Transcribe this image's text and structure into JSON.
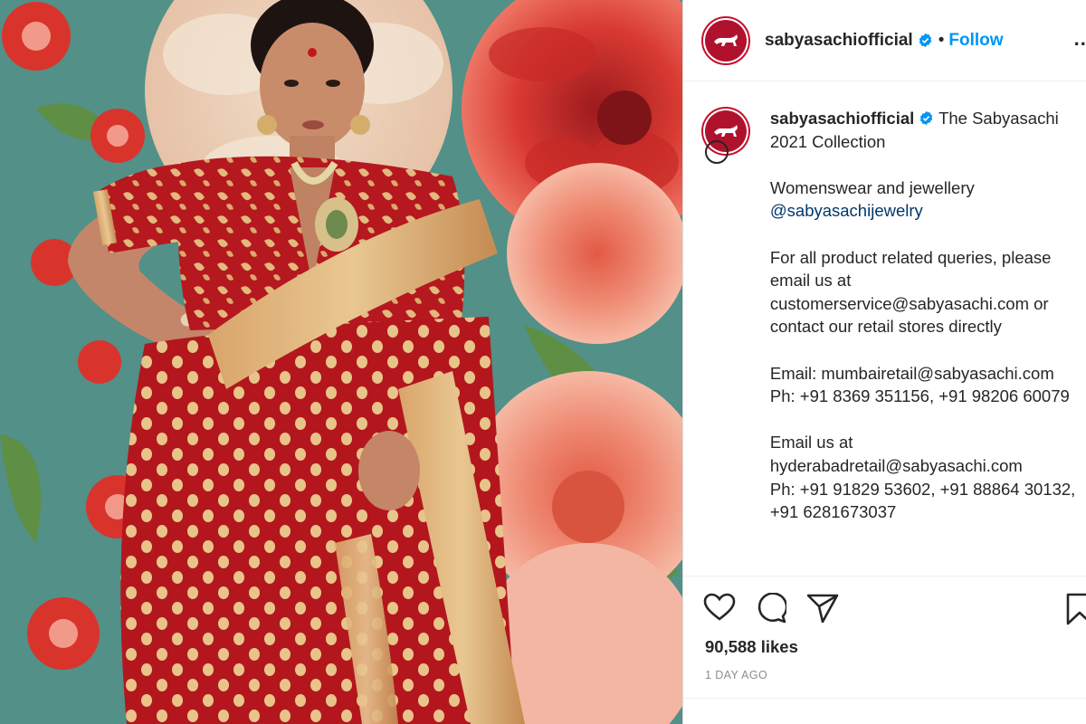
{
  "account": {
    "username": "sabyasachiofficial",
    "separator": "•",
    "follow_label": "Follow",
    "more_label": "...",
    "brand_color": "#b0122d",
    "verified_color": "#0095f6"
  },
  "caption": {
    "username": "sabyasachiofficial",
    "line_intro": "The Sabyasachi 2021 Collection",
    "para_wear": "Womenswear and jewellery",
    "mention": "@sabyasachijewelry",
    "para_queries": "For all product related queries, please email us at customerservice@sabyasachi.com or contact our retail stores directly",
    "para_mumbai": "Email: mumbairetail@sabyasachi.com\nPh: +91 8369 351156, +91 98206 60079",
    "para_hyd": "Email us at hyderabadretail@sabyasachi.com\nPh: +91 91829 53602, +91 88864 30132, +91 6281673037"
  },
  "stats": {
    "likes": "90,588 likes",
    "time_ago": "1 DAY AGO"
  },
  "icons": [
    "heart-icon",
    "comment-icon",
    "share-icon",
    "bookmark-icon",
    "verified-badge-icon",
    "tiger-logo-icon",
    "emoji-icon"
  ]
}
